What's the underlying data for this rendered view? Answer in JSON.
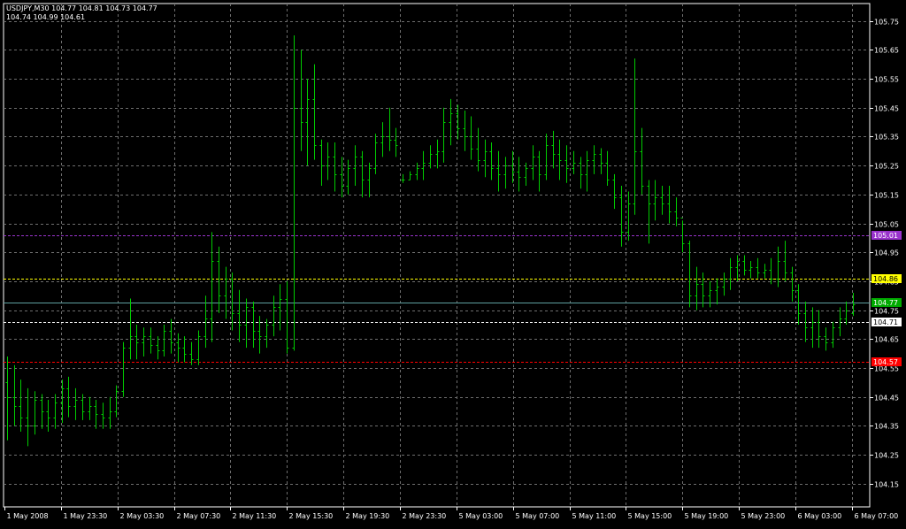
{
  "header": {
    "line1": "USDJPY,M30  104.77 104.81 104.73 104.77",
    "line2": "104.74 104.99 104.61"
  },
  "chart_data": {
    "type": "bar",
    "style": "ohlc",
    "symbol": "USDJPY",
    "timeframe": "M30",
    "grid": true,
    "colors": {
      "background": "#000000",
      "bars": "#00CC00",
      "grid": "#6E6E6E",
      "axis": "#FFFFFF"
    },
    "ylim": [
      104.07,
      105.81
    ],
    "y_ticks": [
      "105.75",
      "105.65",
      "105.55",
      "105.45",
      "105.35",
      "105.25",
      "105.15",
      "105.05",
      "104.95",
      "104.85",
      "104.75",
      "104.65",
      "104.55",
      "104.45",
      "104.35",
      "104.25",
      "104.15"
    ],
    "x_labels": [
      "1 May 2008",
      "1 May 23:30",
      "2 May 03:30",
      "2 May 07:30",
      "2 May 11:30",
      "2 May 15:30",
      "2 May 19:30",
      "2 May 23:30",
      "5 May 03:00",
      "5 May 07:00",
      "5 May 11:00",
      "5 May 15:00",
      "5 May 19:00",
      "5 May 23:00",
      "6 May 03:00",
      "6 May 07:00"
    ],
    "price_lines": [
      {
        "label": "105.01",
        "value": 105.01,
        "color": "#9933CC",
        "label_bg": "#9933CC",
        "label_fg": "#FFFFFF"
      },
      {
        "label": "104.86",
        "value": 104.86,
        "color": "#FFFF00",
        "label_bg": "#FFFF00",
        "label_fg": "#000000"
      },
      {
        "label": "104.77",
        "value": 104.775,
        "color": "#5F9F9F",
        "label_bg": "#00AA00",
        "label_fg": "#FFFFFF"
      },
      {
        "label": "104.71",
        "value": 104.71,
        "color": "#FFFFFF",
        "label_bg": "#FFFFFF",
        "label_fg": "#000000"
      },
      {
        "label": "104.57",
        "value": 104.57,
        "color": "#FF0000",
        "label_bg": "#FF0000",
        "label_fg": "#FFFFFF"
      }
    ],
    "bars": [
      {
        "o": 104.5,
        "h": 104.59,
        "l": 104.3,
        "c": 104.45
      },
      {
        "o": 104.45,
        "h": 104.56,
        "l": 104.35,
        "c": 104.42
      },
      {
        "o": 104.42,
        "h": 104.51,
        "l": 104.33,
        "c": 104.38
      },
      {
        "o": 104.38,
        "h": 104.48,
        "l": 104.28,
        "c": 104.35
      },
      {
        "o": 104.35,
        "h": 104.47,
        "l": 104.32,
        "c": 104.44
      },
      {
        "o": 104.44,
        "h": 104.46,
        "l": 104.34,
        "c": 104.4
      },
      {
        "o": 104.4,
        "h": 104.44,
        "l": 104.33,
        "c": 104.38
      },
      {
        "o": 104.38,
        "h": 104.46,
        "l": 104.34,
        "c": 104.43
      },
      {
        "o": 104.43,
        "h": 104.51,
        "l": 104.36,
        "c": 104.48
      },
      {
        "o": 104.48,
        "h": 104.52,
        "l": 104.38,
        "c": 104.42
      },
      {
        "o": 104.42,
        "h": 104.48,
        "l": 104.37,
        "c": 104.44
      },
      {
        "o": 104.44,
        "h": 104.46,
        "l": 104.37,
        "c": 104.4
      },
      {
        "o": 104.4,
        "h": 104.45,
        "l": 104.37,
        "c": 104.42
      },
      {
        "o": 104.42,
        "h": 104.44,
        "l": 104.34,
        "c": 104.39
      },
      {
        "o": 104.39,
        "h": 104.43,
        "l": 104.34,
        "c": 104.38
      },
      {
        "o": 104.38,
        "h": 104.45,
        "l": 104.34,
        "c": 104.4
      },
      {
        "o": 104.4,
        "h": 104.49,
        "l": 104.38,
        "c": 104.47
      },
      {
        "o": 104.47,
        "h": 104.64,
        "l": 104.45,
        "c": 104.62
      },
      {
        "o": 104.62,
        "h": 104.79,
        "l": 104.58,
        "c": 104.66
      },
      {
        "o": 104.66,
        "h": 104.7,
        "l": 104.58,
        "c": 104.64
      },
      {
        "o": 104.64,
        "h": 104.69,
        "l": 104.59,
        "c": 104.66
      },
      {
        "o": 104.66,
        "h": 104.69,
        "l": 104.6,
        "c": 104.63
      },
      {
        "o": 104.63,
        "h": 104.66,
        "l": 104.58,
        "c": 104.61
      },
      {
        "o": 104.61,
        "h": 104.7,
        "l": 104.59,
        "c": 104.68
      },
      {
        "o": 104.68,
        "h": 104.72,
        "l": 104.6,
        "c": 104.64
      },
      {
        "o": 104.64,
        "h": 104.67,
        "l": 104.57,
        "c": 104.62
      },
      {
        "o": 104.62,
        "h": 104.66,
        "l": 104.57,
        "c": 104.6
      },
      {
        "o": 104.6,
        "h": 104.64,
        "l": 104.56,
        "c": 104.58
      },
      {
        "o": 104.58,
        "h": 104.68,
        "l": 104.56,
        "c": 104.66
      },
      {
        "o": 104.66,
        "h": 104.8,
        "l": 104.62,
        "c": 104.72
      },
      {
        "o": 104.72,
        "h": 105.02,
        "l": 104.64,
        "c": 104.92
      },
      {
        "o": 104.92,
        "h": 104.97,
        "l": 104.74,
        "c": 104.8
      },
      {
        "o": 104.8,
        "h": 104.9,
        "l": 104.72,
        "c": 104.86
      },
      {
        "o": 104.86,
        "h": 104.88,
        "l": 104.68,
        "c": 104.74
      },
      {
        "o": 104.74,
        "h": 104.82,
        "l": 104.64,
        "c": 104.7
      },
      {
        "o": 104.7,
        "h": 104.79,
        "l": 104.62,
        "c": 104.76
      },
      {
        "o": 104.76,
        "h": 104.78,
        "l": 104.62,
        "c": 104.68
      },
      {
        "o": 104.68,
        "h": 104.73,
        "l": 104.6,
        "c": 104.66
      },
      {
        "o": 104.66,
        "h": 104.72,
        "l": 104.62,
        "c": 104.7
      },
      {
        "o": 104.7,
        "h": 104.8,
        "l": 104.66,
        "c": 104.76
      },
      {
        "o": 104.76,
        "h": 104.84,
        "l": 104.68,
        "c": 104.79
      },
      {
        "o": 104.79,
        "h": 104.85,
        "l": 104.6,
        "c": 104.62
      },
      {
        "o": 104.62,
        "h": 105.7,
        "l": 104.61,
        "c": 105.45
      },
      {
        "o": 105.45,
        "h": 105.65,
        "l": 105.3,
        "c": 105.4
      },
      {
        "o": 105.4,
        "h": 105.55,
        "l": 105.25,
        "c": 105.48
      },
      {
        "o": 105.48,
        "h": 105.6,
        "l": 105.27,
        "c": 105.32
      },
      {
        "o": 105.32,
        "h": 105.34,
        "l": 105.18,
        "c": 105.25
      },
      {
        "o": 105.25,
        "h": 105.33,
        "l": 105.2,
        "c": 105.28
      },
      {
        "o": 105.28,
        "h": 105.33,
        "l": 105.16,
        "c": 105.22
      },
      {
        "o": 105.22,
        "h": 105.28,
        "l": 105.14,
        "c": 105.18
      },
      {
        "o": 105.18,
        "h": 105.27,
        "l": 105.15,
        "c": 105.24
      },
      {
        "o": 105.24,
        "h": 105.32,
        "l": 105.18,
        "c": 105.28
      },
      {
        "o": 105.28,
        "h": 105.3,
        "l": 105.14,
        "c": 105.2
      },
      {
        "o": 105.2,
        "h": 105.26,
        "l": 105.14,
        "c": 105.24
      },
      {
        "o": 105.24,
        "h": 105.36,
        "l": 105.22,
        "c": 105.33
      },
      {
        "o": 105.33,
        "h": 105.4,
        "l": 105.28,
        "c": 105.35
      },
      {
        "o": 105.35,
        "h": 105.45,
        "l": 105.3,
        "c": 105.34
      },
      {
        "o": 105.34,
        "h": 105.38,
        "l": 105.28,
        "c": 105.32
      },
      {
        "o": 105.2,
        "h": 105.22,
        "l": 105.19,
        "c": 105.2
      },
      {
        "o": 105.2,
        "h": 105.23,
        "l": 105.2,
        "c": 105.22
      },
      {
        "o": 105.22,
        "h": 105.26,
        "l": 105.2,
        "c": 105.24
      },
      {
        "o": 105.24,
        "h": 105.3,
        "l": 105.2,
        "c": 105.26
      },
      {
        "o": 105.26,
        "h": 105.32,
        "l": 105.24,
        "c": 105.29
      },
      {
        "o": 105.29,
        "h": 105.34,
        "l": 105.24,
        "c": 105.3
      },
      {
        "o": 105.3,
        "h": 105.45,
        "l": 105.26,
        "c": 105.4
      },
      {
        "o": 105.4,
        "h": 105.48,
        "l": 105.32,
        "c": 105.43
      },
      {
        "o": 105.43,
        "h": 105.46,
        "l": 105.34,
        "c": 105.38
      },
      {
        "o": 105.38,
        "h": 105.44,
        "l": 105.3,
        "c": 105.35
      },
      {
        "o": 105.35,
        "h": 105.42,
        "l": 105.27,
        "c": 105.31
      },
      {
        "o": 105.31,
        "h": 105.38,
        "l": 105.23,
        "c": 105.27
      },
      {
        "o": 105.27,
        "h": 105.34,
        "l": 105.21,
        "c": 105.3
      },
      {
        "o": 105.3,
        "h": 105.33,
        "l": 105.2,
        "c": 105.24
      },
      {
        "o": 105.24,
        "h": 105.3,
        "l": 105.16,
        "c": 105.22
      },
      {
        "o": 105.22,
        "h": 105.28,
        "l": 105.17,
        "c": 105.25
      },
      {
        "o": 105.25,
        "h": 105.3,
        "l": 105.19,
        "c": 105.23
      },
      {
        "o": 105.23,
        "h": 105.28,
        "l": 105.16,
        "c": 105.21
      },
      {
        "o": 105.21,
        "h": 105.26,
        "l": 105.18,
        "c": 105.24
      },
      {
        "o": 105.24,
        "h": 105.32,
        "l": 105.2,
        "c": 105.28
      },
      {
        "o": 105.28,
        "h": 105.3,
        "l": 105.16,
        "c": 105.22
      },
      {
        "o": 105.22,
        "h": 105.36,
        "l": 105.2,
        "c": 105.32
      },
      {
        "o": 105.32,
        "h": 105.37,
        "l": 105.24,
        "c": 105.29
      },
      {
        "o": 105.29,
        "h": 105.34,
        "l": 105.2,
        "c": 105.27
      },
      {
        "o": 105.27,
        "h": 105.32,
        "l": 105.19,
        "c": 105.24
      },
      {
        "o": 105.24,
        "h": 105.3,
        "l": 105.22,
        "c": 105.26
      },
      {
        "o": 105.26,
        "h": 105.28,
        "l": 105.17,
        "c": 105.22
      },
      {
        "o": 105.22,
        "h": 105.3,
        "l": 105.16,
        "c": 105.27
      },
      {
        "o": 105.27,
        "h": 105.32,
        "l": 105.22,
        "c": 105.29
      },
      {
        "o": 105.29,
        "h": 105.31,
        "l": 105.22,
        "c": 105.26
      },
      {
        "o": 105.26,
        "h": 105.3,
        "l": 105.18,
        "c": 105.2
      },
      {
        "o": 105.2,
        "h": 105.22,
        "l": 105.1,
        "c": 105.14
      },
      {
        "o": 105.14,
        "h": 105.18,
        "l": 104.97,
        "c": 105.02
      },
      {
        "o": 105.02,
        "h": 105.16,
        "l": 104.99,
        "c": 105.12
      },
      {
        "o": 105.12,
        "h": 105.62,
        "l": 105.08,
        "c": 105.3
      },
      {
        "o": 105.3,
        "h": 105.38,
        "l": 105.15,
        "c": 105.18
      },
      {
        "o": 105.18,
        "h": 105.2,
        "l": 104.98,
        "c": 105.12
      },
      {
        "o": 105.12,
        "h": 105.2,
        "l": 105.06,
        "c": 105.14
      },
      {
        "o": 105.14,
        "h": 105.18,
        "l": 105.08,
        "c": 105.12
      },
      {
        "o": 105.12,
        "h": 105.18,
        "l": 105.05,
        "c": 105.09
      },
      {
        "o": 105.09,
        "h": 105.14,
        "l": 105.04,
        "c": 105.07
      },
      {
        "o": 105.07,
        "h": 105.06,
        "l": 104.95,
        "c": 104.98
      },
      {
        "o": 104.98,
        "h": 104.99,
        "l": 104.76,
        "c": 104.8
      },
      {
        "o": 104.8,
        "h": 104.9,
        "l": 104.75,
        "c": 104.84
      },
      {
        "o": 104.84,
        "h": 104.88,
        "l": 104.76,
        "c": 104.8
      },
      {
        "o": 104.8,
        "h": 104.85,
        "l": 104.76,
        "c": 104.82
      },
      {
        "o": 104.82,
        "h": 104.86,
        "l": 104.77,
        "c": 104.83
      },
      {
        "o": 104.83,
        "h": 104.88,
        "l": 104.8,
        "c": 104.86
      },
      {
        "o": 104.86,
        "h": 104.93,
        "l": 104.82,
        "c": 104.9
      },
      {
        "o": 104.9,
        "h": 104.94,
        "l": 104.85,
        "c": 104.92
      },
      {
        "o": 104.92,
        "h": 104.94,
        "l": 104.87,
        "c": 104.89
      },
      {
        "o": 104.89,
        "h": 104.92,
        "l": 104.86,
        "c": 104.9
      },
      {
        "o": 104.9,
        "h": 104.93,
        "l": 104.86,
        "c": 104.88
      },
      {
        "o": 104.88,
        "h": 104.91,
        "l": 104.86,
        "c": 104.89
      },
      {
        "o": 104.89,
        "h": 104.93,
        "l": 104.84,
        "c": 104.86
      },
      {
        "o": 104.86,
        "h": 104.97,
        "l": 104.83,
        "c": 104.92
      },
      {
        "o": 104.92,
        "h": 104.99,
        "l": 104.85,
        "c": 104.88
      },
      {
        "o": 104.88,
        "h": 104.9,
        "l": 104.78,
        "c": 104.82
      },
      {
        "o": 104.82,
        "h": 104.84,
        "l": 104.7,
        "c": 104.74
      },
      {
        "o": 104.74,
        "h": 104.78,
        "l": 104.64,
        "c": 104.69
      },
      {
        "o": 104.69,
        "h": 104.76,
        "l": 104.62,
        "c": 104.71
      },
      {
        "o": 104.71,
        "h": 104.75,
        "l": 104.62,
        "c": 104.66
      },
      {
        "o": 104.66,
        "h": 104.69,
        "l": 104.61,
        "c": 104.64
      },
      {
        "o": 104.64,
        "h": 104.71,
        "l": 104.62,
        "c": 104.69
      },
      {
        "o": 104.69,
        "h": 104.76,
        "l": 104.66,
        "c": 104.72
      },
      {
        "o": 104.72,
        "h": 104.78,
        "l": 104.7,
        "c": 104.75
      },
      {
        "o": 104.74,
        "h": 104.81,
        "l": 104.73,
        "c": 104.77
      }
    ]
  }
}
